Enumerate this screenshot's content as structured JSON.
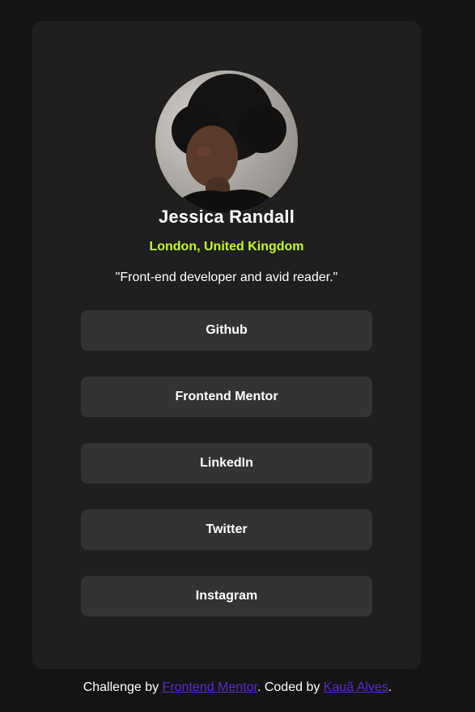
{
  "profile": {
    "name": "Jessica Randall",
    "location": "London, United Kingdom",
    "bio": "\"Front-end developer and avid reader.\""
  },
  "links": [
    {
      "label": "Github"
    },
    {
      "label": "Frontend Mentor"
    },
    {
      "label": "LinkedIn"
    },
    {
      "label": "Twitter"
    },
    {
      "label": "Instagram"
    }
  ],
  "attribution": {
    "prefix": "Challenge by ",
    "challenge_link": "Frontend Mentor",
    "middle": ". Coded by ",
    "author_link": "Kauã Alves",
    "suffix": "."
  },
  "colors": {
    "page_bg": "#141414",
    "card_bg": "#1f1f1f",
    "button_bg": "#333333",
    "accent_green": "#c4f82a",
    "link_purple": "#5a2ec7"
  },
  "icons": {
    "avatar": "avatar-photo"
  }
}
